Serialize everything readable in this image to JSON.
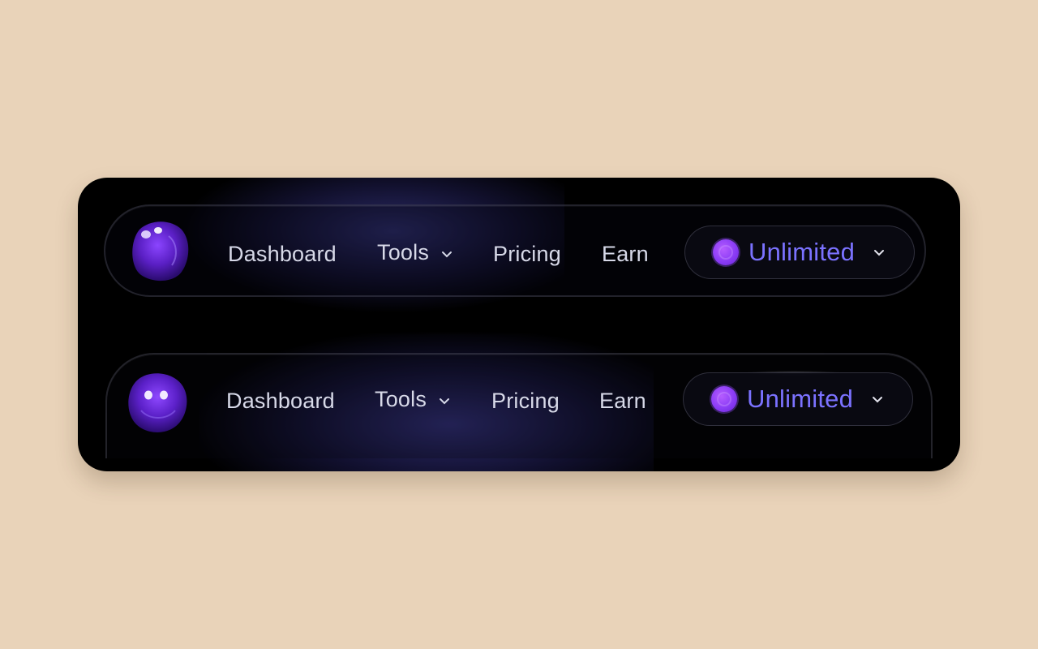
{
  "colors": {
    "page_background": "#e9d3b9",
    "card_background": "#000000",
    "nav_text": "#d7d9e8",
    "plan_text": "#7b72ff",
    "plan_dot": "#8a3cf5"
  },
  "navbars": [
    {
      "logo_icon": "purple-orb-logo-icon",
      "links": {
        "dashboard": "Dashboard",
        "tools": "Tools",
        "pricing": "Pricing",
        "earn": "Earn"
      },
      "plan": {
        "label": "Unlimited",
        "icon": "purple-coin-icon"
      }
    },
    {
      "logo_icon": "purple-orb-face-logo-icon",
      "links": {
        "dashboard": "Dashboard",
        "tools": "Tools",
        "pricing": "Pricing",
        "earn": "Earn"
      },
      "plan": {
        "label": "Unlimited",
        "icon": "purple-coin-icon"
      }
    }
  ]
}
